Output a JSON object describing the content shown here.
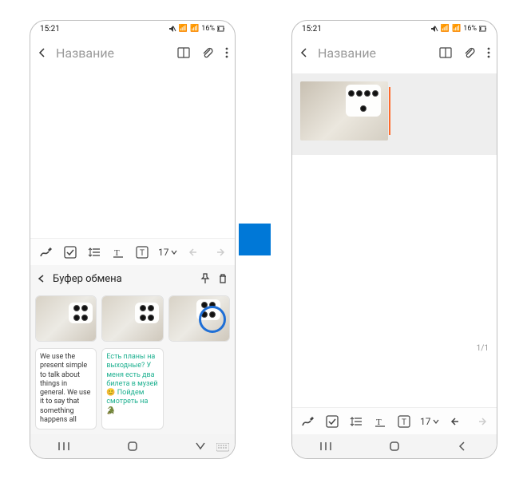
{
  "status": {
    "time": "15:21",
    "battery": "16%"
  },
  "header": {
    "title": "Название"
  },
  "toolbar": {
    "font_size": "17"
  },
  "clipboard": {
    "title": "Буфер обмена",
    "card1": "We use the present simple to talk about things in general. We use it to say that something happens all",
    "card2": "Есть планы на выходные? У меня есть два билета в музей 😊 Пойдем смотреть на 🐊"
  },
  "right": {
    "page_counter": "1/1"
  }
}
